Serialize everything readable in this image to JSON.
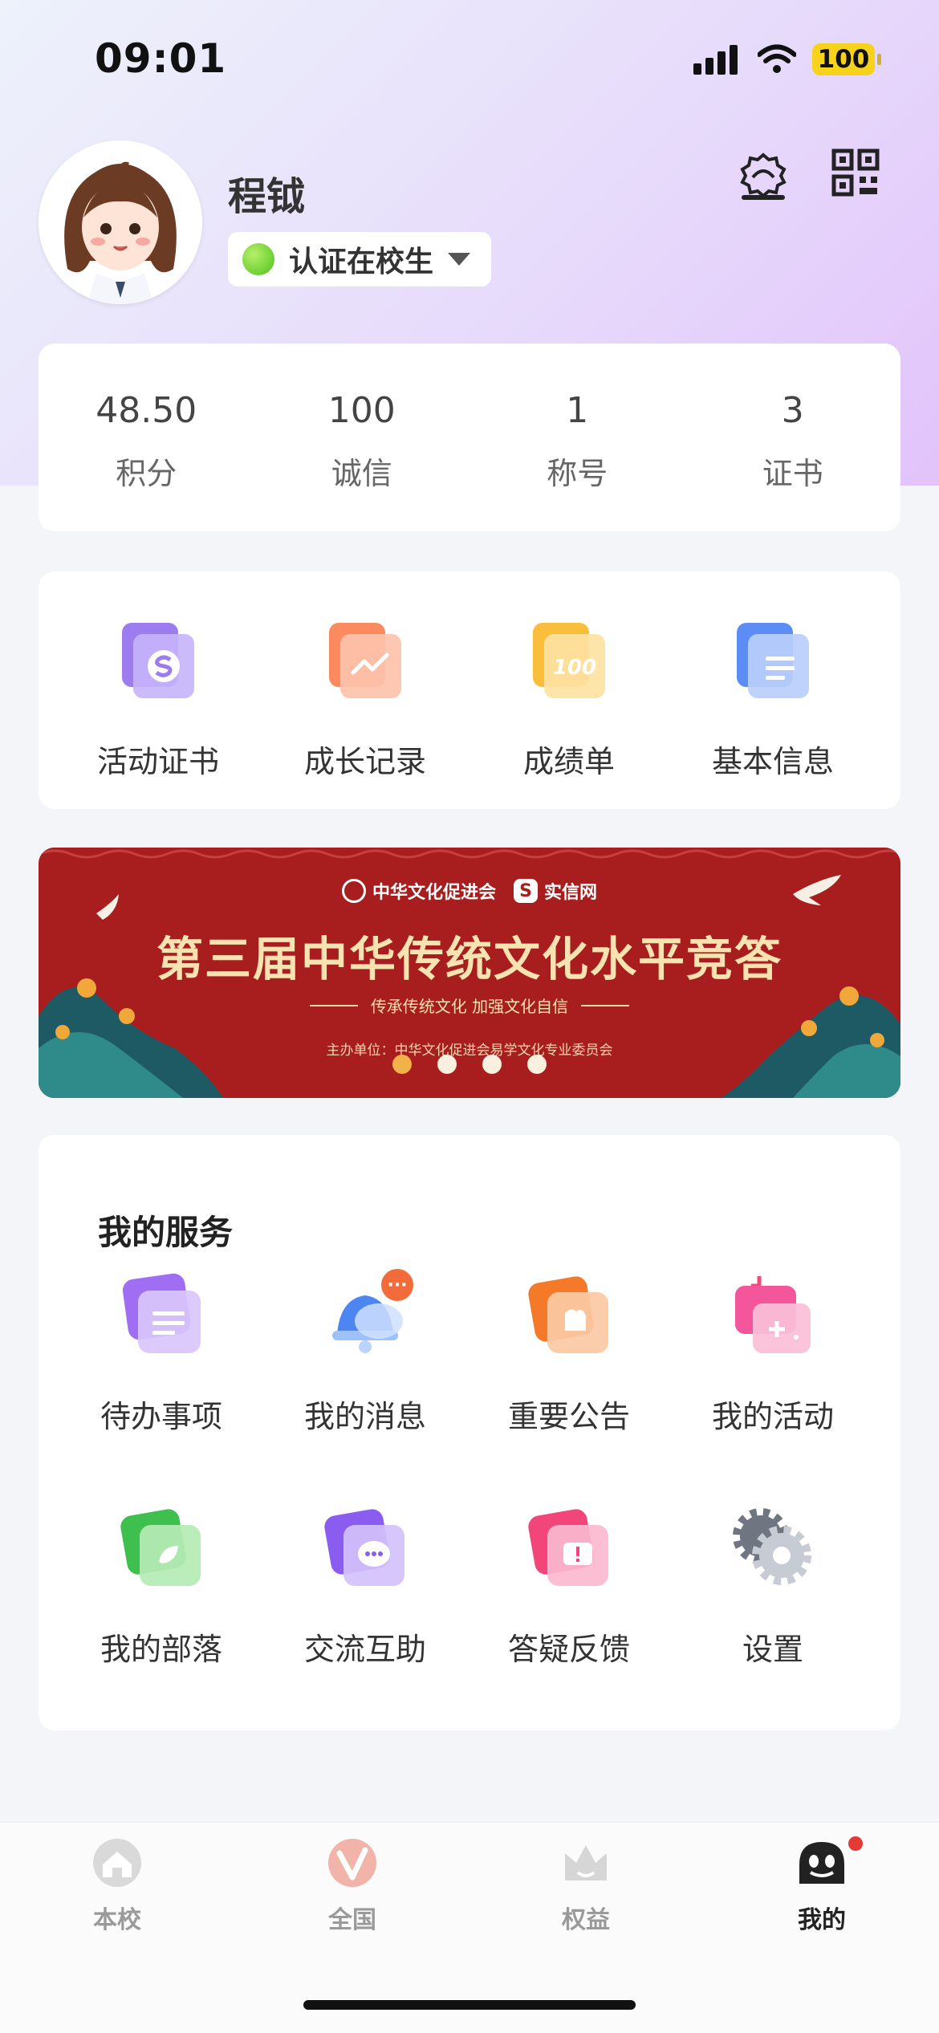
{
  "status_bar": {
    "time": "09:01",
    "battery": "100"
  },
  "profile": {
    "name": "程钺",
    "badge": "认证在校生"
  },
  "stats": [
    {
      "value": "48.50",
      "label": "积分"
    },
    {
      "value": "100",
      "label": "诚信"
    },
    {
      "value": "1",
      "label": "称号"
    },
    {
      "value": "3",
      "label": "证书"
    }
  ],
  "quick_links": [
    {
      "label": "活动证书",
      "icon": "certificate-icon"
    },
    {
      "label": "成长记录",
      "icon": "growth-chart-icon"
    },
    {
      "label": "成绩单",
      "icon": "transcript-icon"
    },
    {
      "label": "基本信息",
      "icon": "info-document-icon"
    }
  ],
  "banner": {
    "org1": "中华文化促进会",
    "org2": "实信网",
    "title": "第三届中华传统文化水平竞答",
    "subtitle": "传承传统文化 加强文化自信",
    "host": "主办单位：中华文化促进会易学文化专业委员会",
    "slide_count": 4,
    "active_slide": 1
  },
  "services": {
    "title": "我的服务",
    "items": [
      {
        "label": "待办事项",
        "icon": "todo-list-icon"
      },
      {
        "label": "我的消息",
        "icon": "message-bell-icon",
        "badge": "···"
      },
      {
        "label": "重要公告",
        "icon": "announcement-icon"
      },
      {
        "label": "我的活动",
        "icon": "activity-icon"
      },
      {
        "label": "我的部落",
        "icon": "tribe-icon"
      },
      {
        "label": "交流互助",
        "icon": "chat-help-icon"
      },
      {
        "label": "答疑反馈",
        "icon": "feedback-icon"
      },
      {
        "label": "设置",
        "icon": "settings-gear-icon"
      }
    ]
  },
  "tabbar": [
    {
      "label": "本校",
      "icon": "school-home-icon"
    },
    {
      "label": "全国",
      "icon": "national-v-icon"
    },
    {
      "label": "权益",
      "icon": "rights-crown-icon"
    },
    {
      "label": "我的",
      "icon": "profile-ghost-icon",
      "active": true
    }
  ],
  "colors": {
    "accent_red": "#e53935",
    "banner_red": "#a81d1d",
    "badge_green": "#4cc31a",
    "battery_yellow": "#f6d31a"
  }
}
